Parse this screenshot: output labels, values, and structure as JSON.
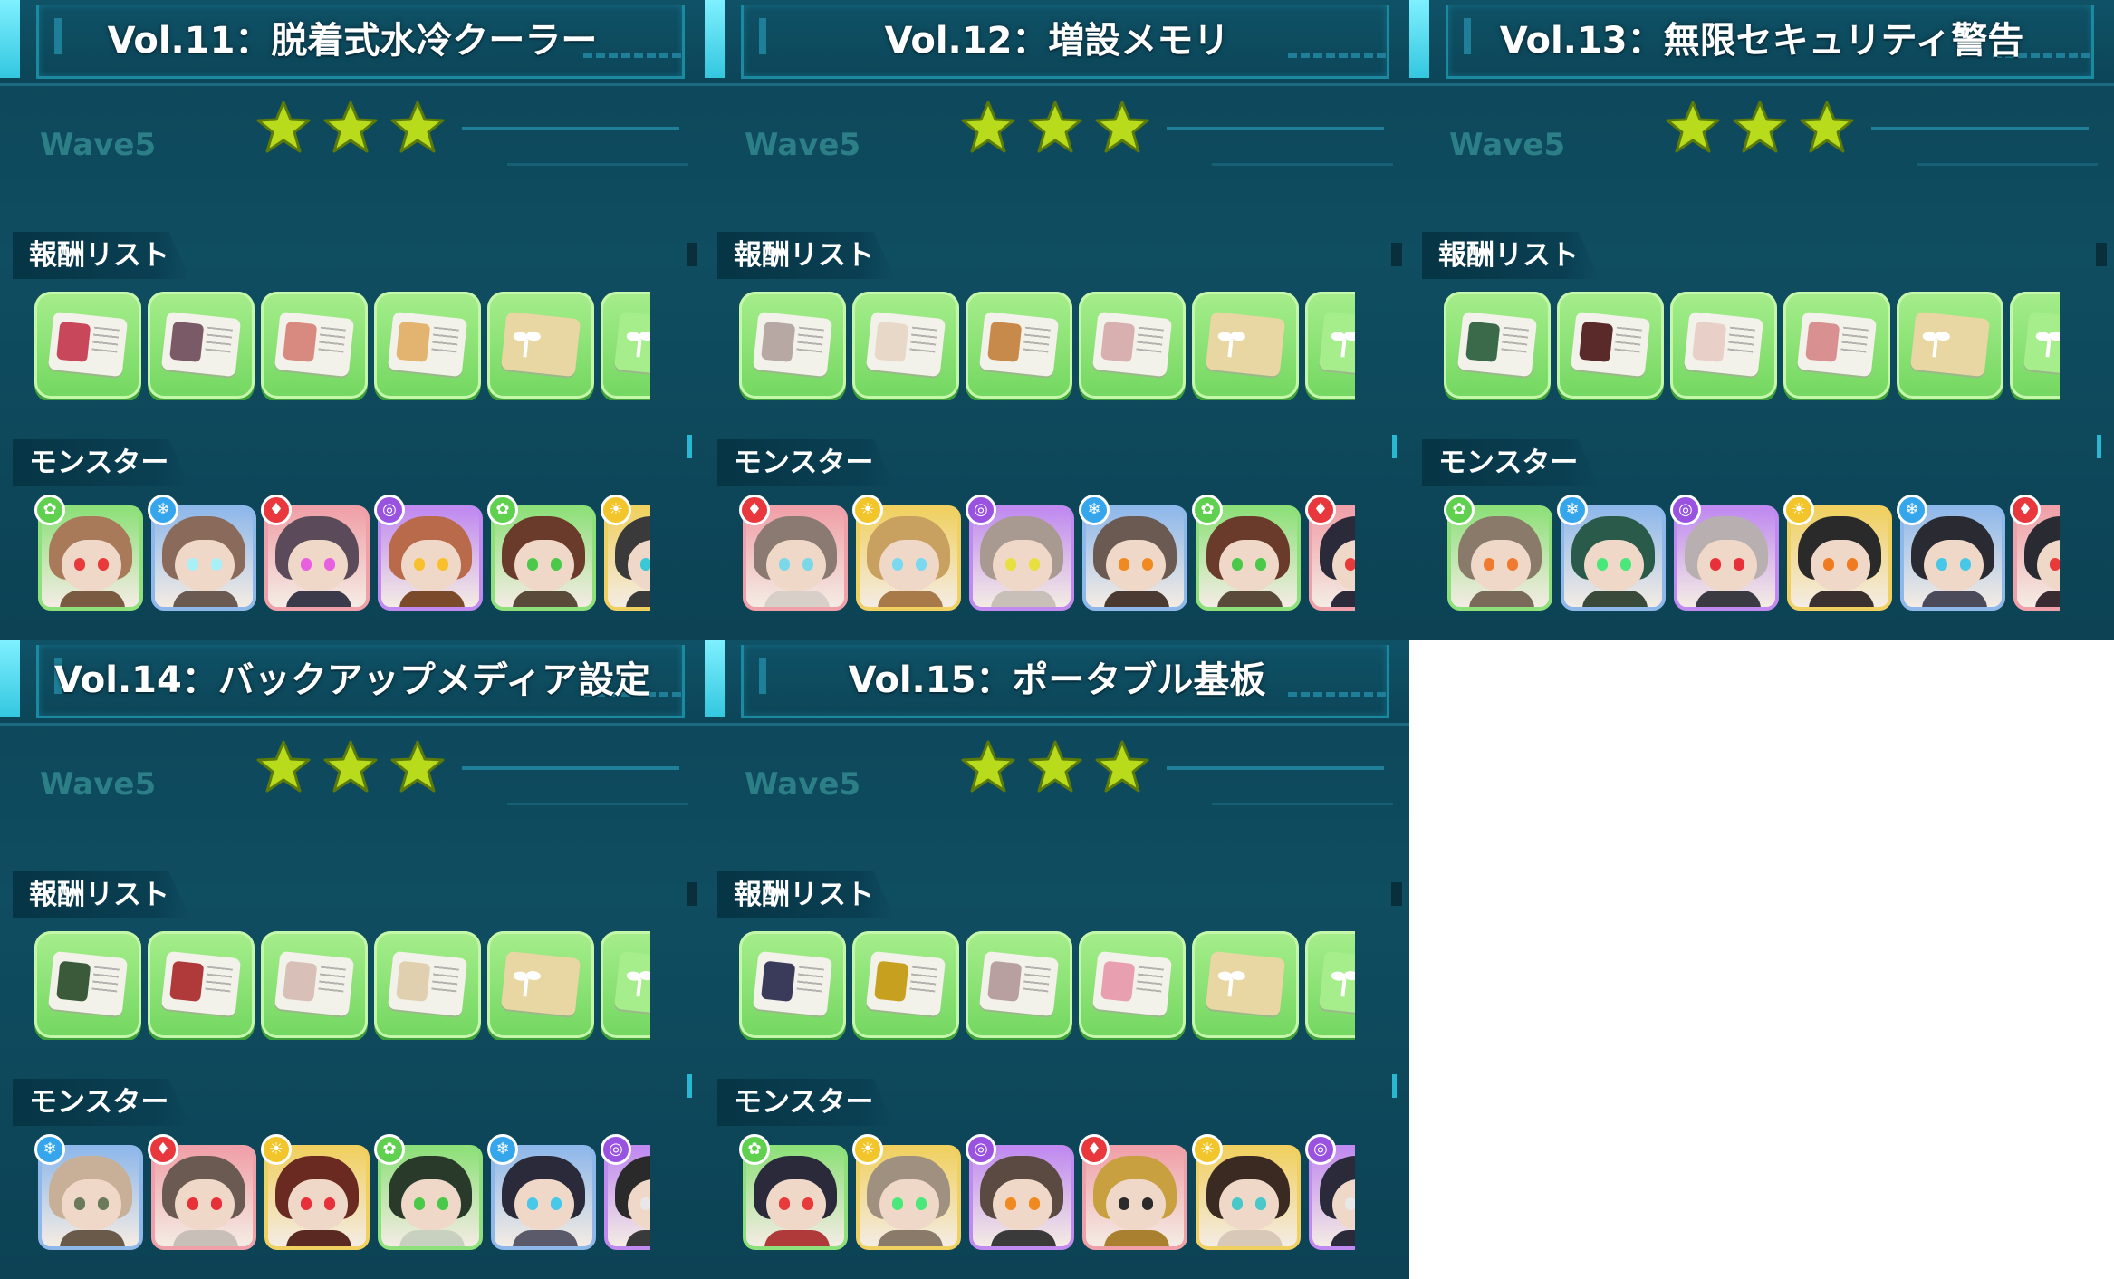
{
  "colors": {
    "star": "#b8dc1c",
    "wood": "#5fd14f",
    "water": "#35a6ec",
    "fire": "#e8383e",
    "light": "#f2c52a",
    "dark": "#9a52e0"
  },
  "panels": [
    {
      "title": "Vol.11：脱着式水冷クーラー",
      "wave": "Wave5",
      "stars": 3,
      "reward_label": "報酬リスト",
      "monster_label": "モンスター",
      "rewards": [
        {
          "kind": "card",
          "color": "#c9475a"
        },
        {
          "kind": "card",
          "color": "#7a5a66"
        },
        {
          "kind": "card",
          "color": "#d98a80"
        },
        {
          "kind": "card",
          "color": "#e3b470"
        },
        {
          "kind": "seed",
          "color": "#e8d7a2"
        },
        {
          "kind": "seed",
          "color": "#a6ee8c"
        }
      ],
      "monsters": [
        {
          "element": "wood",
          "hair": "#a87a5a",
          "eye": "#e83a3a",
          "body": "#7a5a40",
          "border": "#8ee07a"
        },
        {
          "element": "water",
          "hair": "#8a6a5a",
          "eye": "#a8f0f8",
          "body": "#6a5a52",
          "border": "#8fb8ea"
        },
        {
          "element": "fire",
          "hair": "#5a4a5a",
          "eye": "#e860e0",
          "body": "#3a3a4a",
          "border": "#f0a0a8"
        },
        {
          "element": "dark",
          "hair": "#b86a4a",
          "eye": "#f8c02a",
          "body": "#7a4a2a",
          "border": "#c08af0"
        },
        {
          "element": "wood",
          "hair": "#6a3a2a",
          "eye": "#4ac84a",
          "body": "#5a4a3a",
          "border": "#8ee07a"
        },
        {
          "element": "light",
          "hair": "#3a3a3a",
          "eye": "#3ac8d8",
          "body": "#3a3a3a",
          "border": "#f0d060"
        }
      ]
    },
    {
      "title": "Vol.12：増設メモリ",
      "wave": "Wave5",
      "stars": 3,
      "reward_label": "報酬リスト",
      "monster_label": "モンスター",
      "rewards": [
        {
          "kind": "card",
          "color": "#b8a8a4"
        },
        {
          "kind": "card",
          "color": "#e8d8c8"
        },
        {
          "kind": "card",
          "color": "#c88a4a"
        },
        {
          "kind": "card",
          "color": "#d8b0b0"
        },
        {
          "kind": "seed",
          "color": "#e8d7a2"
        },
        {
          "kind": "seed",
          "color": "#a6ee8c"
        }
      ],
      "monsters": [
        {
          "element": "fire",
          "hair": "#8a7a72",
          "eye": "#7ad8e8",
          "body": "#d8d0c8",
          "border": "#f0a0a8"
        },
        {
          "element": "light",
          "hair": "#c8a060",
          "eye": "#7ad8f0",
          "body": "#a87a4a",
          "border": "#f0d060"
        },
        {
          "element": "dark",
          "hair": "#a89a90",
          "eye": "#e8e040",
          "body": "#c8c0b8",
          "border": "#c08af0"
        },
        {
          "element": "water",
          "hair": "#6a5a52",
          "eye": "#f08a20",
          "body": "#4a3a32",
          "border": "#8fb8ea"
        },
        {
          "element": "wood",
          "hair": "#6a3a2a",
          "eye": "#4ac84a",
          "body": "#5a4a3a",
          "border": "#8ee07a"
        },
        {
          "element": "fire",
          "hair": "#2a2a3a",
          "eye": "#e83a3a",
          "body": "#2a2a3a",
          "border": "#f0a0a8"
        }
      ]
    },
    {
      "title": "Vol.13：無限セキュリティ警告",
      "wave": "Wave5",
      "stars": 3,
      "reward_label": "報酬リスト",
      "monster_label": "モンスター",
      "rewards": [
        {
          "kind": "card",
          "color": "#3a6a4a"
        },
        {
          "kind": "card",
          "color": "#5a2a2a"
        },
        {
          "kind": "card",
          "color": "#e8d0c8"
        },
        {
          "kind": "card",
          "color": "#d89090"
        },
        {
          "kind": "seed",
          "color": "#e8d7a2"
        },
        {
          "kind": "seed",
          "color": "#a6ee8c"
        }
      ],
      "monsters": [
        {
          "element": "wood",
          "hair": "#8a7a6a",
          "eye": "#f07a30",
          "body": "#7a6a5a",
          "border": "#8ee07a"
        },
        {
          "element": "water",
          "hair": "#2a5a4a",
          "eye": "#4ae87a",
          "body": "#3a4a3a",
          "border": "#8fb8ea"
        },
        {
          "element": "dark",
          "hair": "#b8b0b0",
          "eye": "#e8303a",
          "body": "#3a3a42",
          "border": "#c08af0"
        },
        {
          "element": "light",
          "hair": "#2a2a2a",
          "eye": "#f07a20",
          "body": "#3a3030",
          "border": "#f0d060"
        },
        {
          "element": "water",
          "hair": "#2a2a32",
          "eye": "#48c8e8",
          "body": "#4a4a5a",
          "border": "#8fb8ea"
        },
        {
          "element": "fire",
          "hair": "#2a2a32",
          "eye": "#e83a3a",
          "body": "#3a2a32",
          "border": "#f0a0a8"
        }
      ]
    },
    {
      "title": "Vol.14：バックアップメディア設定",
      "wave": "Wave5",
      "stars": 3,
      "reward_label": "報酬リスト",
      "monster_label": "モンスター",
      "rewards": [
        {
          "kind": "card",
          "color": "#3a5a3a"
        },
        {
          "kind": "card",
          "color": "#b03a3a"
        },
        {
          "kind": "card",
          "color": "#d8c0b8"
        },
        {
          "kind": "card",
          "color": "#e0d0b0"
        },
        {
          "kind": "seed",
          "color": "#e8d7a2"
        },
        {
          "kind": "seed",
          "color": "#a6ee8c"
        }
      ],
      "monsters": [
        {
          "element": "water",
          "hair": "#c8b098",
          "eye": "#6a7a5a",
          "body": "#6a5a4a",
          "border": "#8fb8ea"
        },
        {
          "element": "fire",
          "hair": "#6a5a52",
          "eye": "#e8303a",
          "body": "#c8c0b8",
          "border": "#f0a0a8"
        },
        {
          "element": "light",
          "hair": "#6a2a22",
          "eye": "#e8303a",
          "body": "#5a2a22",
          "border": "#f0d060"
        },
        {
          "element": "wood",
          "hair": "#2a3a2a",
          "eye": "#4ac84a",
          "body": "#c8d0c0",
          "border": "#8ee07a"
        },
        {
          "element": "water",
          "hair": "#2a2a3a",
          "eye": "#48c8e8",
          "body": "#5a5a6a",
          "border": "#8fb8ea"
        },
        {
          "element": "dark",
          "hair": "#2a2a2a",
          "eye": "#e8e8e8",
          "body": "#3a3a3a",
          "border": "#c08af0"
        }
      ]
    },
    {
      "title": "Vol.15：ポータブル基板",
      "wave": "Wave5",
      "stars": 3,
      "reward_label": "報酬リスト",
      "monster_label": "モンスター",
      "rewards": [
        {
          "kind": "card",
          "color": "#3a3a5a"
        },
        {
          "kind": "card",
          "color": "#c8a020"
        },
        {
          "kind": "card",
          "color": "#b8a0a0"
        },
        {
          "kind": "card",
          "color": "#e8a0b0"
        },
        {
          "kind": "seed",
          "color": "#e8d7a2"
        },
        {
          "kind": "seed",
          "color": "#a6ee8c"
        }
      ],
      "monsters": [
        {
          "element": "wood",
          "hair": "#2a2a3a",
          "eye": "#e83a3a",
          "body": "#b03a3a",
          "border": "#8ee07a"
        },
        {
          "element": "light",
          "hair": "#a09080",
          "eye": "#4ae87a",
          "body": "#8a7a6a",
          "border": "#f0d060"
        },
        {
          "element": "dark",
          "hair": "#5a4a42",
          "eye": "#f08a20",
          "body": "#3a3a3a",
          "border": "#c08af0"
        },
        {
          "element": "fire",
          "hair": "#c8a040",
          "eye": "#2a2a2a",
          "body": "#a88030",
          "border": "#f0a0a8"
        },
        {
          "element": "light",
          "hair": "#3a2a22",
          "eye": "#48c8c8",
          "body": "#d8c8b8",
          "border": "#f0d060"
        },
        {
          "element": "dark",
          "hair": "#2a2a3a",
          "eye": "#e8e8e8",
          "body": "#2a2a3a",
          "border": "#c08af0"
        }
      ]
    }
  ]
}
